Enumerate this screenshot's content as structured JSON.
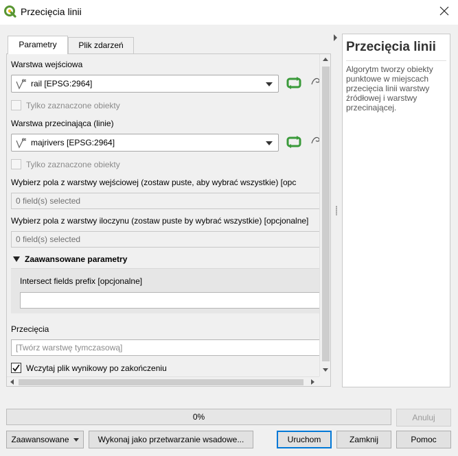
{
  "window": {
    "title": "Przecięcia linii"
  },
  "tabs": [
    {
      "label": "Parametry",
      "active": true
    },
    {
      "label": "Plik zdarzeń",
      "active": false
    }
  ],
  "params": {
    "input_layer_label": "Warstwa wejściowa",
    "input_layer_value": "rail [EPSG:2964]",
    "input_selected_only": "Tylko zaznaczone obiekty",
    "intersect_layer_label": "Warstwa przecinająca (linie)",
    "intersect_layer_value": "majrivers [EPSG:2964]",
    "intersect_selected_only": "Tylko zaznaczone obiekty",
    "input_fields_label": "Wybierz pola z warstwy wejściowej (zostaw puste, aby wybrać wszystkie) [opc",
    "input_fields_value": "0 field(s) selected",
    "intersect_fields_label": "Wybierz pola z warstwy iloczynu (zostaw puste by wybrać wszystkie) [opcjonalne]",
    "intersect_fields_value": "0 field(s) selected",
    "advanced_header": "Zaawansowane parametry",
    "prefix_label": "Intersect fields prefix [opcjonalne]",
    "prefix_value": "",
    "output_label": "Przecięcia",
    "output_placeholder": "[Twórz warstwę tymczasową]",
    "load_result_label": "Wczytaj plik wynikowy po zakończeniu",
    "load_result_checked": true
  },
  "help": {
    "title": "Przecięcia linii",
    "text": "Algorytm tworzy obiekty punktowe w miejscach przecięcia linii warstwy źródłowej i warstwy przecinającej."
  },
  "progress": {
    "value": 0,
    "label": "0%"
  },
  "buttons": {
    "cancel": "Anuluj",
    "advanced": "Zaawansowane",
    "batch": "Wykonaj jako przetwarzanie wsadowe...",
    "run": "Uruchom",
    "close": "Zamknij",
    "help": "Pomoc"
  },
  "colors": {
    "qgis_green": "#589632",
    "qgis_yellow": "#f0b41e",
    "iterate_green": "#3a9a3a",
    "focus_blue": "#0078d7"
  },
  "icons": [
    "qgis-logo-icon",
    "close-icon",
    "line-layer-icon",
    "iterate-icon",
    "edit-icon",
    "chevron-down-icon",
    "checkmark-icon"
  ]
}
